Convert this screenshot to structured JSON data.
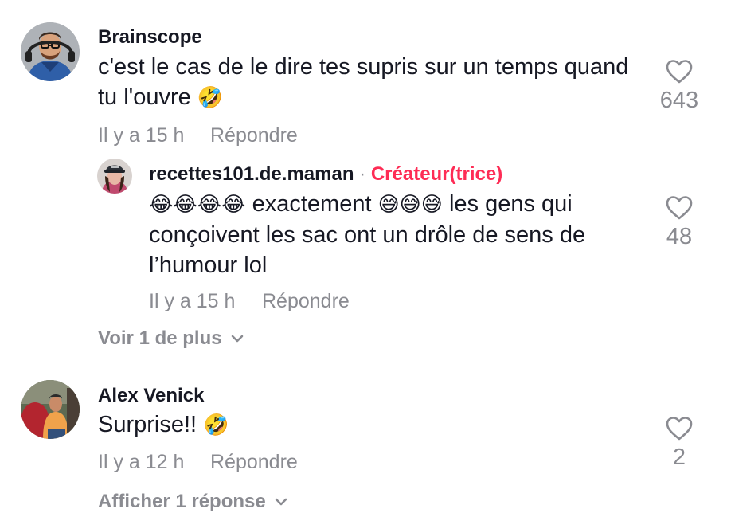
{
  "comments": [
    {
      "username": "Brainscope",
      "text_line1": "c'est le cas de le dire tes supris sur un temps quand",
      "text_line2": "tu l'ouvre",
      "emoji": "🤣",
      "time": "Il y a 15 h",
      "reply_label": "Répondre",
      "likes": "643",
      "replies": [
        {
          "username": "recettes101.de.maman",
          "separator": "·",
          "badge": "Créateur(trice)",
          "emoji_lead": "😂😂😂😂",
          "text_line1_mid": "exactement",
          "emoji_mid": "😅😅😅",
          "text_line1_end": "les gens qui",
          "text_line2": "conçoivent les sac ont un drôle de sens de",
          "text_line3": "l’humour lol",
          "time": "Il y a 15 h",
          "reply_label": "Répondre",
          "likes": "48"
        }
      ],
      "more_label": "Voir 1 de plus"
    },
    {
      "username": "Alex Venick",
      "text_line1": "Surprise!!",
      "emoji": "🤣",
      "time": "Il y a 12 h",
      "reply_label": "Répondre",
      "likes": "2",
      "more_label": "Afficher 1 réponse"
    }
  ]
}
